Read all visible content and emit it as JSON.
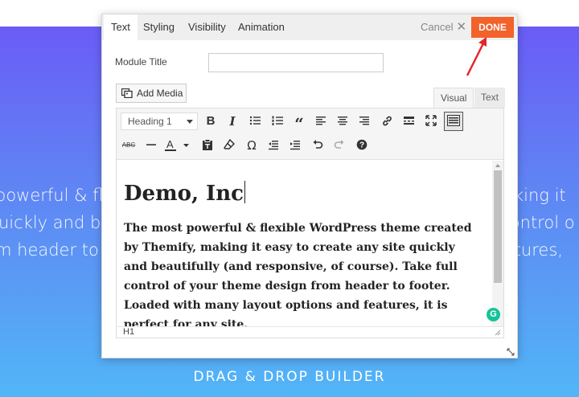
{
  "background": {
    "hero_lines": [
      "powerful & flexible WordPress theme created by Themify, making it",
      "uickly and beautifully (and responsive, of course). Take full control o",
      "m header to footer. Loaded with many layout options and features,"
    ],
    "footer_label": "DRAG & DROP BUILDER"
  },
  "dialog": {
    "tabs": [
      {
        "label": "Text",
        "active": true
      },
      {
        "label": "Styling",
        "active": false
      },
      {
        "label": "Visibility",
        "active": false
      },
      {
        "label": "Animation",
        "active": false
      }
    ],
    "cancel_label": "Cancel",
    "done_label": "DONE",
    "module_title_label": "Module Title",
    "module_title_value": "",
    "add_media_label": "Add Media",
    "mode_tabs": {
      "visual": "Visual",
      "text": "Text"
    },
    "toolbar": {
      "format_select": "Heading 1",
      "row1_icons": [
        "bold-icon",
        "italic-icon",
        "bullet-list-icon",
        "numbered-list-icon",
        "blockquote-icon",
        "align-left-icon",
        "align-center-icon",
        "align-right-icon",
        "link-icon",
        "read-more-icon",
        "fullscreen-icon",
        "toolbar-toggle-icon"
      ],
      "row2_icons": [
        "strikethrough-icon",
        "horizontal-line-icon",
        "text-color-icon",
        "paste-as-text-icon",
        "clear-formatting-icon",
        "special-character-icon",
        "outdent-icon",
        "indent-icon",
        "undo-icon",
        "redo-icon",
        "help-icon"
      ]
    },
    "content": {
      "heading": "Demo, Inc",
      "paragraph": "The most powerful & flexible WordPress theme created by Themify, making it easy to create any site quickly and beautifully (and responsive, of course). Take full control of your theme design from header to footer. Loaded with many layout options and features, it is perfect for any site.",
      "status_path": "H1"
    },
    "colors": {
      "done": "#f2622a",
      "arrow": "#e3262b",
      "grammarly": "#15c39a"
    }
  }
}
